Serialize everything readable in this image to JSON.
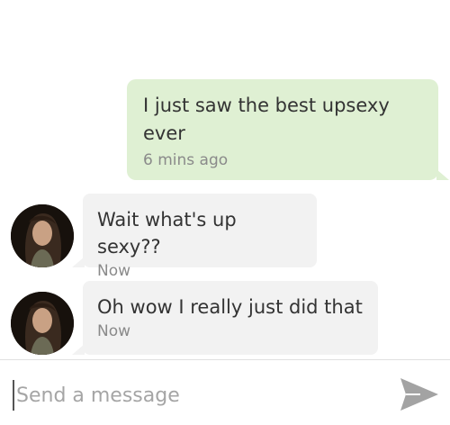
{
  "conversation": {
    "messages": [
      {
        "direction": "outgoing",
        "text": "I just saw the best upsexy ever",
        "time": "6 mins ago"
      },
      {
        "direction": "incoming",
        "text": "Wait what's up sexy??",
        "time": "Now",
        "avatar_icon": "user-avatar"
      },
      {
        "direction": "incoming",
        "text": "Oh wow I really just did that",
        "time": "Now",
        "avatar_icon": "user-avatar"
      }
    ]
  },
  "composer": {
    "placeholder": "Send a message",
    "send_icon": "send-icon"
  },
  "colors": {
    "outgoing_bubble": "#dff0d3",
    "incoming_bubble": "#f2f2f2",
    "send_icon": "#a3a3a3"
  }
}
